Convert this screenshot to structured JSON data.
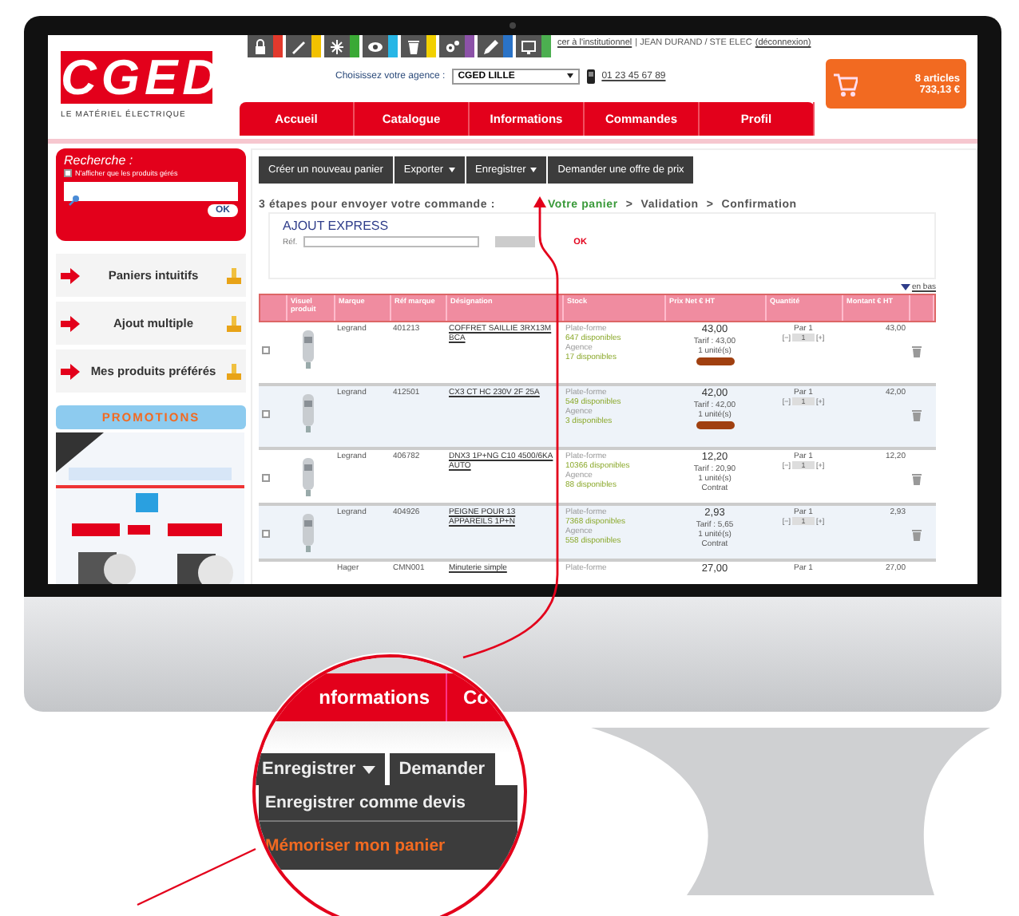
{
  "header": {
    "logo": "CGED",
    "tagline": "LE MATÉRIEL ÉLECTRIQUE",
    "icon_tabs": [
      {
        "kind": "lock",
        "color": "#e2392c"
      },
      {
        "kind": "pen",
        "color": "#f2c100"
      },
      {
        "kind": "snowflake",
        "color": "#3aa935"
      },
      {
        "kind": "eye",
        "color": "#27b6e6"
      },
      {
        "kind": "bin",
        "color": "#f2d000"
      },
      {
        "kind": "gears",
        "color": "#8c52a8"
      },
      {
        "kind": "pencil",
        "color": "#2a73c7"
      },
      {
        "kind": "monitor",
        "color": "#4caf50"
      }
    ],
    "account_link": "cer à l'institutionnel",
    "account_text": "| JEAN DURAND / STE ELEC",
    "logout_link": "(déconnexion)",
    "agency_label": "Choisissez votre agence :",
    "agency_select": "CGED LILLE",
    "phone": "01 23 45 67 89"
  },
  "nav": {
    "tabs": [
      "Accueil",
      "Catalogue",
      "Informations",
      "Commandes",
      "Profil"
    ]
  },
  "cart": {
    "count": "8 articles",
    "total": "733,13 €"
  },
  "sidebar": {
    "search": {
      "title": "Recherche :",
      "filter_label": "N'afficher que les produits gérés",
      "filter_checked": false,
      "button": "OK"
    },
    "links": [
      "Paniers intuitifs",
      "Ajout multiple",
      "Mes produits préférés"
    ],
    "promotions": {
      "title": "PROMOTIONS"
    }
  },
  "toolbar": [
    {
      "label": "Créer un nouveau panier",
      "dropdown": false
    },
    {
      "label": "Exporter",
      "dropdown": true
    },
    {
      "label": "Enregistrer",
      "dropdown": true
    },
    {
      "label": "Demander une offre de prix",
      "dropdown": false
    }
  ],
  "steps": {
    "title": "3 étapes pour envoyer votre commande :",
    "separator": ">",
    "items": [
      {
        "label": "Votre panier",
        "selected": true
      },
      {
        "label": "Validation",
        "selected": false
      },
      {
        "label": "Confirmation",
        "selected": false
      }
    ]
  },
  "express": {
    "title": "AJOUT EXPRESS",
    "ref_label": "Réf.",
    "button": "OK"
  },
  "table": {
    "bottom_link": "en bas",
    "columns": [
      "",
      "Visuel produit",
      "Marque",
      "Réf marque",
      "Désignation",
      "Stock",
      "Prix Net € HT",
      "Quantité",
      "Montant € HT",
      ""
    ],
    "rows": [
      {
        "checked": false,
        "brand": "Legrand",
        "ref": "401213",
        "designation": "COFFRET SAILLIE 3RX13M BCA",
        "stock": {
          "platform_label": "Plate-forme",
          "platform": "647 disponibles",
          "agency_label": "Agence",
          "agency": "17 disponibles"
        },
        "price": "43,00",
        "tariff": "Tarif : 43,00",
        "units": "1 unité(s)",
        "badge": true,
        "pack": "Par 1",
        "minus": "[−]",
        "qty": "1",
        "plus": "[+]",
        "amount": "43,00"
      },
      {
        "checked": false,
        "brand": "Legrand",
        "ref": "412501",
        "designation": "CX3 CT HC 230V 2F 25A",
        "stock": {
          "platform_label": "Plate-forme",
          "platform": "549 disponibles",
          "agency_label": "Agence",
          "agency": "3 disponibles"
        },
        "price": "42,00",
        "tariff": "Tarif : 42,00",
        "units": "1 unité(s)",
        "badge": true,
        "pack": "Par 1",
        "minus": "[−]",
        "qty": "1",
        "plus": "[+]",
        "amount": "42,00"
      },
      {
        "checked": false,
        "brand": "Legrand",
        "ref": "406782",
        "designation": "DNX3 1P+NG C10 4500/6KA AUTO",
        "stock": {
          "platform_label": "Plate-forme",
          "platform": "10366 disponibles",
          "agency_label": "Agence",
          "agency": "88 disponibles"
        },
        "price": "12,20",
        "tariff": "Tarif : 20,90",
        "units": "1 unité(s)",
        "condition": "Contrat",
        "pack": "Par 1",
        "minus": "[−]",
        "qty": "1",
        "plus": "[+]",
        "amount": "12,20"
      },
      {
        "checked": false,
        "brand": "Legrand",
        "ref": "404926",
        "designation": "PEIGNE POUR 13 APPAREILS 1P+N",
        "stock": {
          "platform_label": "Plate-forme",
          "platform": "7368 disponibles",
          "agency_label": "Agence",
          "agency": "558 disponibles"
        },
        "price": "2,93",
        "tariff": "Tarif : 5,65",
        "units": "1 unité(s)",
        "condition": "Contrat",
        "pack": "Par 1",
        "minus": "[−]",
        "qty": "1",
        "plus": "[+]",
        "amount": "2,93"
      },
      {
        "brand": "Hager",
        "ref": "CMN001",
        "designation": "Minuterie simple",
        "stock": {
          "platform_label": "Plate-forme"
        },
        "price": "27,00",
        "pack": "Par 1",
        "amount": "27,00"
      }
    ]
  },
  "magnifier": {
    "nav": [
      "nformations",
      "Co"
    ],
    "buttons": [
      {
        "label": "Enregistrer",
        "dropdown": true
      },
      {
        "label": "Demander",
        "dropdown": false
      }
    ],
    "menu": [
      {
        "label": "Enregistrer comme devis",
        "highlighted": false
      },
      {
        "label": "Mémoriser mon panier",
        "highlighted": true
      }
    ]
  }
}
